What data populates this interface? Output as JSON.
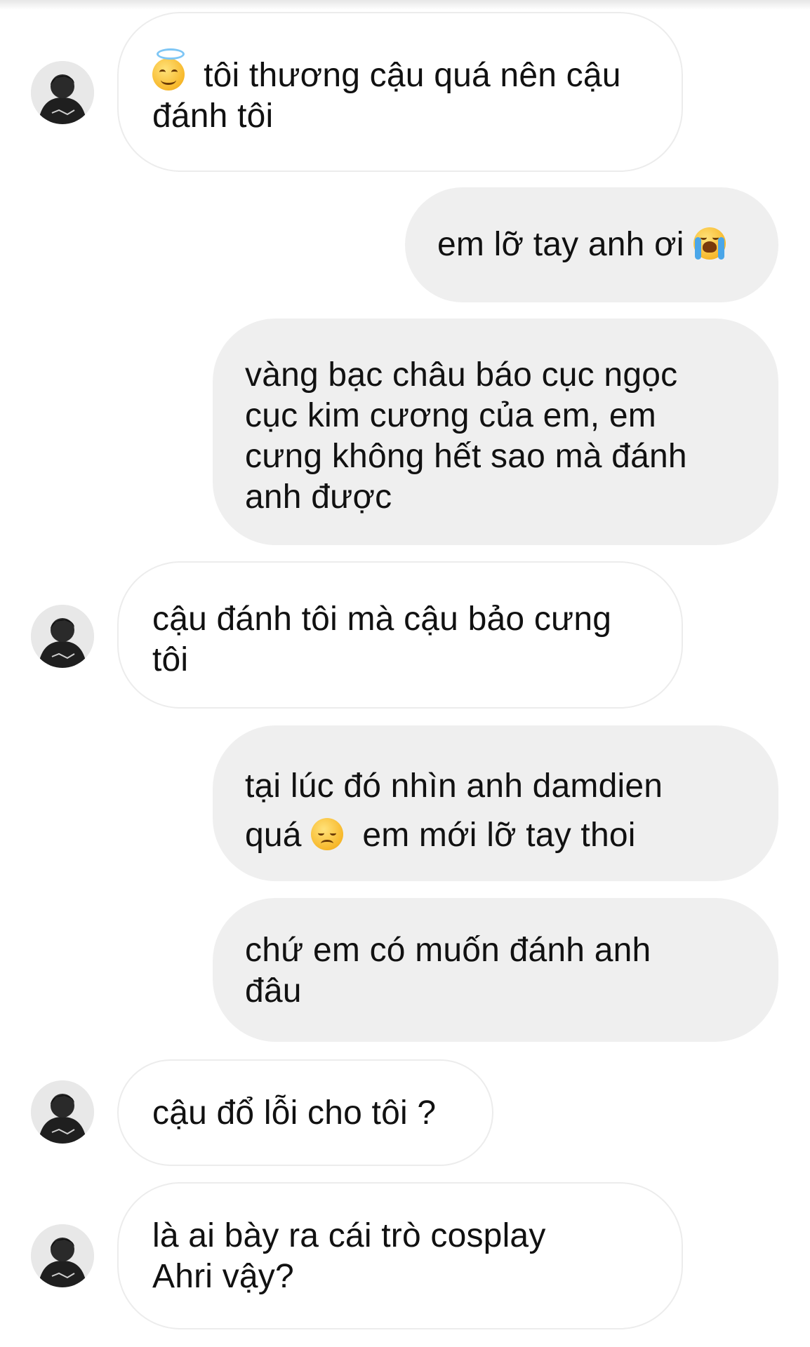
{
  "conversation": {
    "messages": [
      {
        "sender": "other",
        "parts": [
          "",
          "tôi thương cậu quá nên cậu",
          "đánh tôi"
        ],
        "emoji": "smiling-face-with-halo-icon"
      },
      {
        "sender": "me",
        "text": "em lỡ tay anh ơi",
        "emoji": "loudly-crying-face-icon"
      },
      {
        "sender": "me",
        "lines": [
          "vàng bạc châu báo cục ngọc",
          "cục kim cương của em, em",
          "cưng không hết sao mà đánh",
          "anh được"
        ]
      },
      {
        "sender": "other",
        "lines": [
          "cậu đánh tôi mà cậu bảo cưng",
          "tôi"
        ]
      },
      {
        "sender": "me",
        "line1": "tại lúc đó nhìn anh damdien",
        "line2_before": "quá",
        "line2_after": "em mới lỡ tay thoi",
        "emoji": "disappointed-face-icon"
      },
      {
        "sender": "me",
        "lines": [
          "chứ em có muốn đánh anh",
          "đâu"
        ]
      },
      {
        "sender": "other",
        "lines": [
          "cậu đổ lỗi cho tôi ?"
        ]
      },
      {
        "sender": "other",
        "lines": [
          "là ai bày ra cái trò cosplay",
          "Ahri vậy?"
        ]
      }
    ]
  },
  "colors": {
    "incoming_bubble": "#ffffff",
    "incoming_border": "#ececec",
    "outgoing_bubble": "#efefef",
    "text": "#111111"
  }
}
